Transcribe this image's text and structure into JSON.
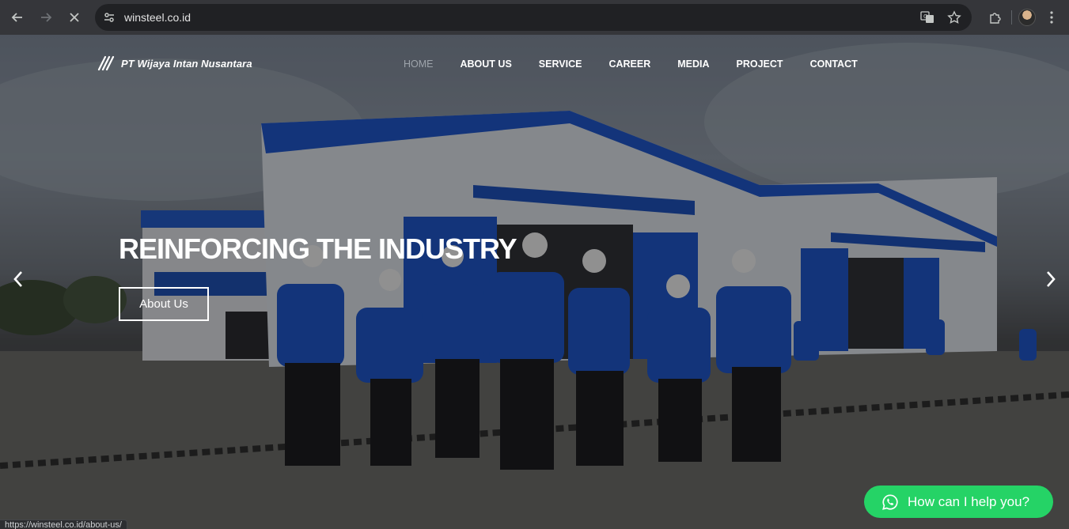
{
  "browser": {
    "url": "winsteel.co.id",
    "icons": {
      "back": "arrow-left-icon",
      "forward": "arrow-right-icon",
      "stop": "close-icon",
      "site_info": "tune-icon",
      "translate": "translate-icon",
      "bookmark": "star-icon",
      "extensions": "puzzle-icon",
      "menu": "more-vertical-icon"
    }
  },
  "site": {
    "logo_text": "PT Wijaya Intan Nusantara",
    "nav": [
      {
        "label": "HOME",
        "active": true
      },
      {
        "label": "ABOUT US"
      },
      {
        "label": "SERVICE"
      },
      {
        "label": "CAREER"
      },
      {
        "label": "MEDIA"
      },
      {
        "label": "PROJECT"
      },
      {
        "label": "CONTACT"
      }
    ]
  },
  "hero": {
    "title": "REINFORCING THE INDUSTRY",
    "button_label": "About Us",
    "prev_arrow": "‹",
    "next_arrow": "›"
  },
  "whatsapp": {
    "label": "How can I help you?",
    "color": "#25d366"
  },
  "status_bar": {
    "link": "https://winsteel.co.id/about-us/"
  },
  "colors": {
    "building_blue": "#1e4fb5",
    "uniform_blue": "#1f55c6",
    "nav_active": "#9ea4ab"
  }
}
